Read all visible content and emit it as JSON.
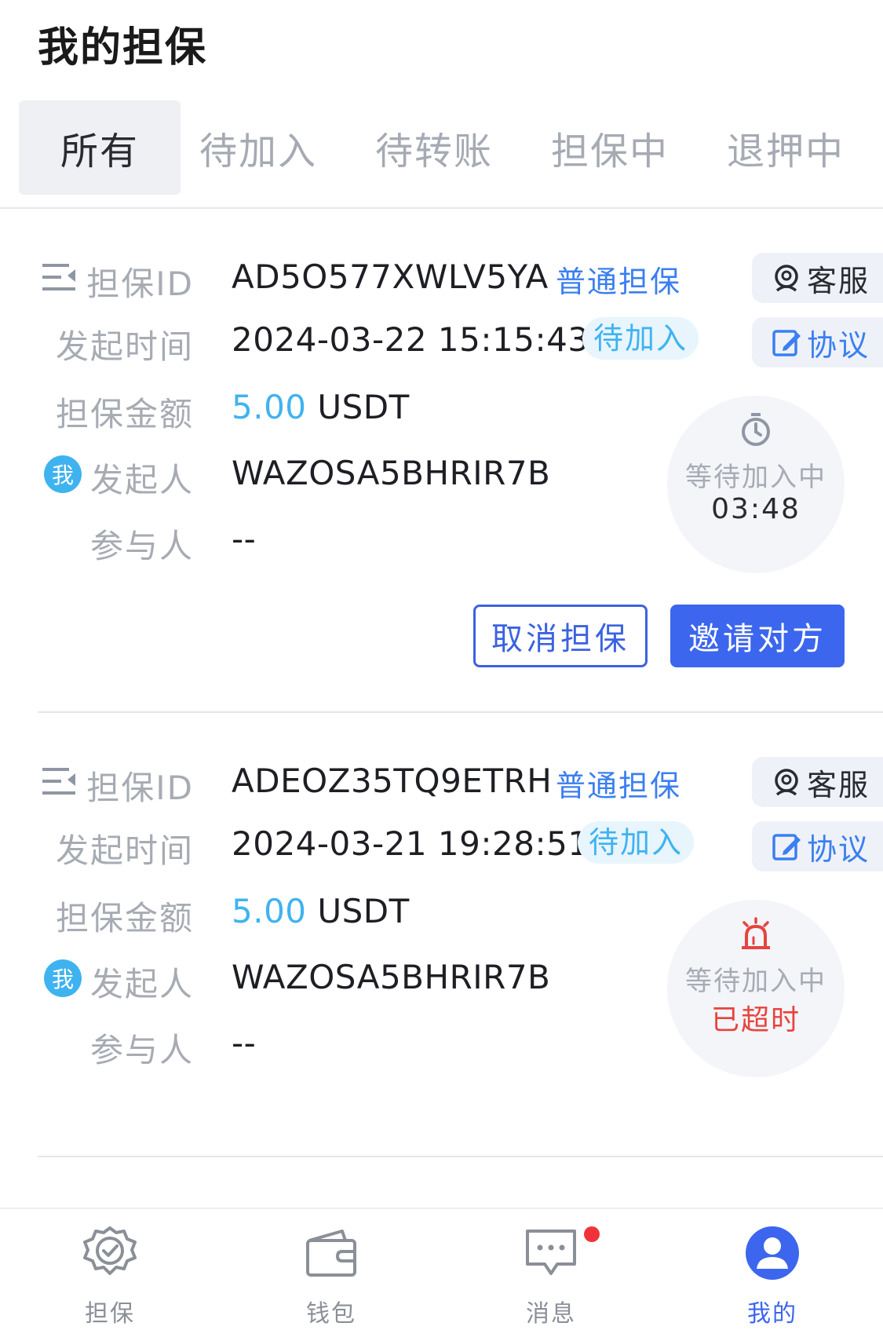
{
  "page": {
    "title": "我的担保"
  },
  "tabs": [
    {
      "label": "所有",
      "active": true
    },
    {
      "label": "待加入",
      "active": false
    },
    {
      "label": "待转账",
      "active": false
    },
    {
      "label": "担保中",
      "active": false
    },
    {
      "label": "退押中",
      "active": false
    }
  ],
  "labels": {
    "id": "担保ID",
    "time": "发起时间",
    "amount": "担保金额",
    "initiator": "发起人",
    "participant": "参与人",
    "me_badge": "我",
    "service": "客服",
    "protocol": "协议"
  },
  "cards": [
    {
      "id": "AD5O577XWLV5YA",
      "type": "普通担保",
      "time": "2024-03-22 15:15:43",
      "status": "待加入",
      "amount_value": "5.00",
      "amount_unit": "USDT",
      "initiator": "WAZOSA5BHRIR7B",
      "participant": "--",
      "timer_title": "等待加入中",
      "timer_value": "03:48",
      "timer_icon": "stopwatch-icon",
      "cancel_label": "取消担保",
      "invite_label": "邀请对方"
    },
    {
      "id": "ADEOZ35TQ9ETRH",
      "type": "普通担保",
      "time": "2024-03-21 19:28:51",
      "status": "待加入",
      "amount_value": "5.00",
      "amount_unit": "USDT",
      "initiator": "WAZOSA5BHRIR7B",
      "participant": "--",
      "timer_title": "等待加入中",
      "timer_value": "已超时",
      "timer_icon": "alarm-siren-icon"
    }
  ],
  "colors": {
    "accent": "#3c66ee",
    "amount": "#3fb3f0",
    "timeout": "#e8433e",
    "muted": "#a7abb3"
  },
  "nav": [
    {
      "label": "担保",
      "icon": "shield-check-icon",
      "active": false
    },
    {
      "label": "钱包",
      "icon": "wallet-icon",
      "active": false
    },
    {
      "label": "消息",
      "icon": "message-icon",
      "active": false,
      "has_dot": true
    },
    {
      "label": "我的",
      "icon": "user-icon",
      "active": true
    }
  ]
}
